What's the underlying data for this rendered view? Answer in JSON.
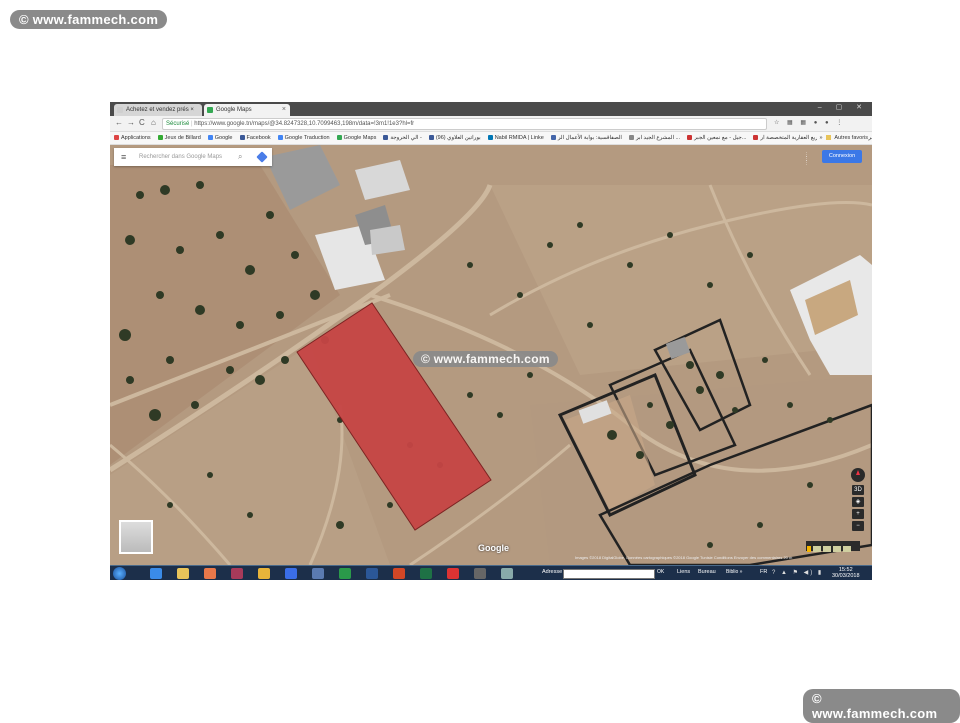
{
  "watermark": {
    "text": "© www.fammech.com"
  },
  "browser": {
    "tabs": [
      {
        "label": "Achetez et vendez prés ×",
        "active": false,
        "favicon_color": "#cfcfcf"
      },
      {
        "label": "Google Maps",
        "active": true,
        "favicon_color": "#34a853"
      }
    ],
    "close_symbol": "×",
    "window_buttons": "– ▢ ✕",
    "nav": {
      "back": "←",
      "forward": "→",
      "reload": "C",
      "home": "⌂"
    },
    "address": {
      "secure_label": "Sécurisé",
      "url": "https://www.google.tn/maps/@34.8247328,10.7099463,198m/data=!3m1!1e3?hl=fr"
    },
    "right_icons": "☆ ▦ ▦ ● ● ⋮",
    "bookmarks": [
      {
        "label": "Applications",
        "color": "#d44"
      },
      {
        "label": "Jeux de Billard",
        "color": "#3a3"
      },
      {
        "label": "Google",
        "color": "#4285f4"
      },
      {
        "label": "Facebook",
        "color": "#3b5998"
      },
      {
        "label": "Google Traduction",
        "color": "#4285f4"
      },
      {
        "label": "Google Maps",
        "color": "#34a853"
      },
      {
        "label": "الي الخروجة -",
        "color": "#3b5998"
      },
      {
        "label": "(96) بوراتين العلاوي",
        "color": "#3b5998"
      },
      {
        "label": "Nabil RMIDA | Linke",
        "color": "#0077b5"
      },
      {
        "label": "الصفاقسية: بوابة الأعمال الر",
        "color": "#46a"
      },
      {
        "label": "المشرع الجيد ابر ...",
        "color": "#888"
      },
      {
        "label": "جيل - مع نمعين الجبر...",
        "color": "#c33"
      },
      {
        "label": "المشاريع العقارية المتخصصة ار",
        "color": "#c33"
      },
      {
        "label": "اكتب - طريق الإسلام",
        "color": "#a80"
      }
    ],
    "bookmarks_more": "»",
    "autres_favoris": "Autres favoris"
  },
  "maps": {
    "search_placeholder": "Rechercher dans Google Maps",
    "menu_icon": "≡",
    "search_icon": "⌕",
    "apps_icon": "⋮⋮⋮",
    "connexion_label": "Connexion",
    "google_logo": "Google",
    "attribution": "Images ©2018 DigitalGlobe, Données cartographiques ©2018 Google   Tunisie   Conditions   Envoyer des commentaires   20 m",
    "controls": [
      "3D",
      "◈",
      "+",
      "−"
    ],
    "highlight_color": "#c64545",
    "terrain_color": "#b49a80"
  },
  "taskbar": {
    "adresse_label": "Adresse",
    "go_label": "OK",
    "liens_label": "Liens",
    "bureau_label": "Bureau",
    "biblio_label": "Biblio »",
    "lang": "FR",
    "tray": "? ▲ ⚑ ◀) ▮",
    "time": "15:52",
    "date": "30/03/2018",
    "apps": [
      {
        "name": "ie",
        "color": "#3a8be8"
      },
      {
        "name": "folder",
        "color": "#e8c45a"
      },
      {
        "name": "media",
        "color": "#e8784a"
      },
      {
        "name": "winrar",
        "color": "#a83a5a"
      },
      {
        "name": "chrome",
        "color": "#e8b43a"
      },
      {
        "name": "outlook",
        "color": "#3a6ee8"
      },
      {
        "name": "users",
        "color": "#5a7ab0"
      },
      {
        "name": "d-app",
        "color": "#2a9a4a"
      },
      {
        "name": "word",
        "color": "#2b5797"
      },
      {
        "name": "powerpoint",
        "color": "#d24726"
      },
      {
        "name": "excel",
        "color": "#1e7145"
      },
      {
        "name": "pdf",
        "color": "#d33"
      },
      {
        "name": "calc",
        "color": "#666"
      },
      {
        "name": "notepad",
        "color": "#8aa"
      }
    ]
  }
}
